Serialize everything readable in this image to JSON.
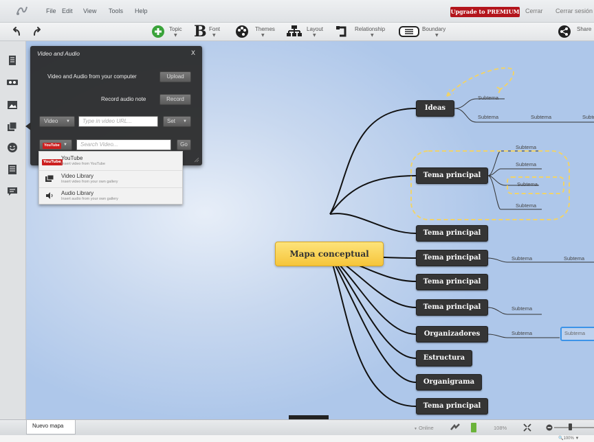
{
  "menubar": {
    "items": [
      "File",
      "Edit",
      "View",
      "Tools",
      "Help"
    ],
    "upgrade": "Upgrade to PREMIUM",
    "cerrar": "Cerrar",
    "cerrar_sesion": "Cerrar sesión"
  },
  "toolbar": {
    "topic": "Topic",
    "font": "Font",
    "themes": "Themes",
    "layout": "Layout",
    "relationship": "Relationship",
    "boundary": "Boundary",
    "share": "Share"
  },
  "popup": {
    "title": "Video and Audio",
    "close": "X",
    "upload_label": "Video and Audio from your computer",
    "upload_btn": "Upload",
    "record_label": "Record audio note",
    "record_btn": "Record",
    "video_select": "Video",
    "video_url_placeholder": "Type in video URL...",
    "set_btn": "Set",
    "search_placeholder": "Search Video...",
    "go_btn": "Go",
    "youtube_badge": "YouTube"
  },
  "dropdown": {
    "items": [
      {
        "title": "YouTube",
        "desc": "Insert video from YouTube"
      },
      {
        "title": "Video Library",
        "desc": "Insert video from your own gallery"
      },
      {
        "title": "Audio Library",
        "desc": "Insert audio from your own gallery"
      }
    ]
  },
  "map": {
    "central": "Mapa conceptual",
    "topics": [
      "Ideas",
      "Tema principal",
      "Tema principal",
      "Tema principal",
      "Tema principal",
      "Tema principal",
      "Organizadores",
      "Estructura",
      "Organigrama",
      "Tema principal"
    ],
    "subtopic": "Subtema",
    "accent": "#3b93e8",
    "central_color": "#f6c53a"
  },
  "status": {
    "tab": "Nuevo mapa",
    "online": "Online",
    "zoom": "108%",
    "zoom_bottom": "100%"
  }
}
